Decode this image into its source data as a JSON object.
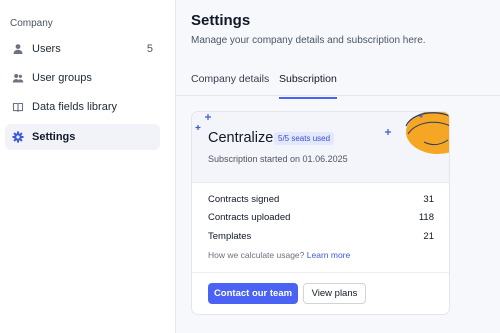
{
  "sidebar": {
    "section_label": "Company",
    "items": [
      {
        "label": "Users",
        "icon": "user-icon",
        "count": "5"
      },
      {
        "label": "User groups",
        "icon": "users-group-icon"
      },
      {
        "label": "Data fields library",
        "icon": "book-icon"
      },
      {
        "label": "Settings",
        "icon": "gear-icon",
        "active": true
      }
    ]
  },
  "header": {
    "title": "Settings",
    "subtitle": "Manage your company details and subscription here."
  },
  "tabs": [
    {
      "label": "Company details",
      "active": false
    },
    {
      "label": "Subscription",
      "active": true
    }
  ],
  "subscription": {
    "plan_name": "Centralize",
    "seats_badge": "5/5 seats used",
    "started": "Subscription started on 01.06.2025",
    "usage": [
      {
        "label": "Contracts signed",
        "value": "31"
      },
      {
        "label": "Contracts uploaded",
        "value": "118"
      },
      {
        "label": "Templates",
        "value": "21"
      }
    ],
    "help_text": "How we calculate usage?",
    "help_link": "Learn more",
    "primary_button": "Contact our team",
    "secondary_button": "View plans"
  },
  "colors": {
    "accent": "#4a63f5",
    "decoration_orange": "#f5a623",
    "decoration_navy": "#2b3a67"
  }
}
